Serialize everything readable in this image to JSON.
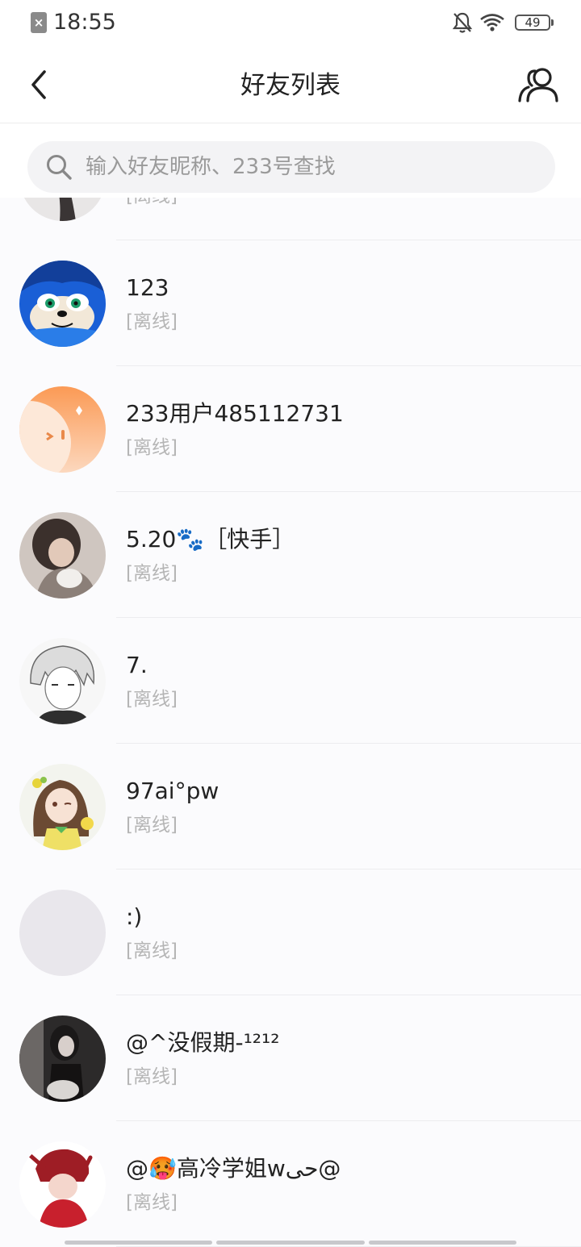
{
  "status_bar": {
    "time": "18:55",
    "battery": "49",
    "icons": [
      "sim-blocked-icon",
      "mute-bell-icon",
      "wifi-icon",
      "battery-icon"
    ]
  },
  "header": {
    "title": "好友列表",
    "back_icon": "chevron-left-icon",
    "action_icon": "friends-icon"
  },
  "search": {
    "placeholder": "输入好友昵称、233号查找",
    "value": ""
  },
  "friends": [
    {
      "name": "",
      "status": "[离线]",
      "avatar": "dark-figure"
    },
    {
      "name": "123",
      "status": "[离线]",
      "avatar": "blue-hedgehog"
    },
    {
      "name": "233用户485112731",
      "status": "[离线]",
      "avatar": "orange-default"
    },
    {
      "name": "5.20🐾［快手］",
      "status": "[离线]",
      "avatar": "photo-girl"
    },
    {
      "name": "7.",
      "status": "[离线]",
      "avatar": "sketch-boy"
    },
    {
      "name": "97ai°pw",
      "status": "[离线]",
      "avatar": "anime-girl"
    },
    {
      "name": ":)",
      "status": "[离线]",
      "avatar": "empty-gray"
    },
    {
      "name": "@^没假期-¹²¹²",
      "status": "[离线]",
      "avatar": "photo-dark"
    },
    {
      "name": "@🥵高冷学姐ᴡﺣﻰ@",
      "status": "[离线]",
      "avatar": "red-character"
    }
  ],
  "colors": {
    "background": "#fbfbfd",
    "status_offline": "#b5b5b5",
    "search_bg": "#f3f3f5"
  }
}
